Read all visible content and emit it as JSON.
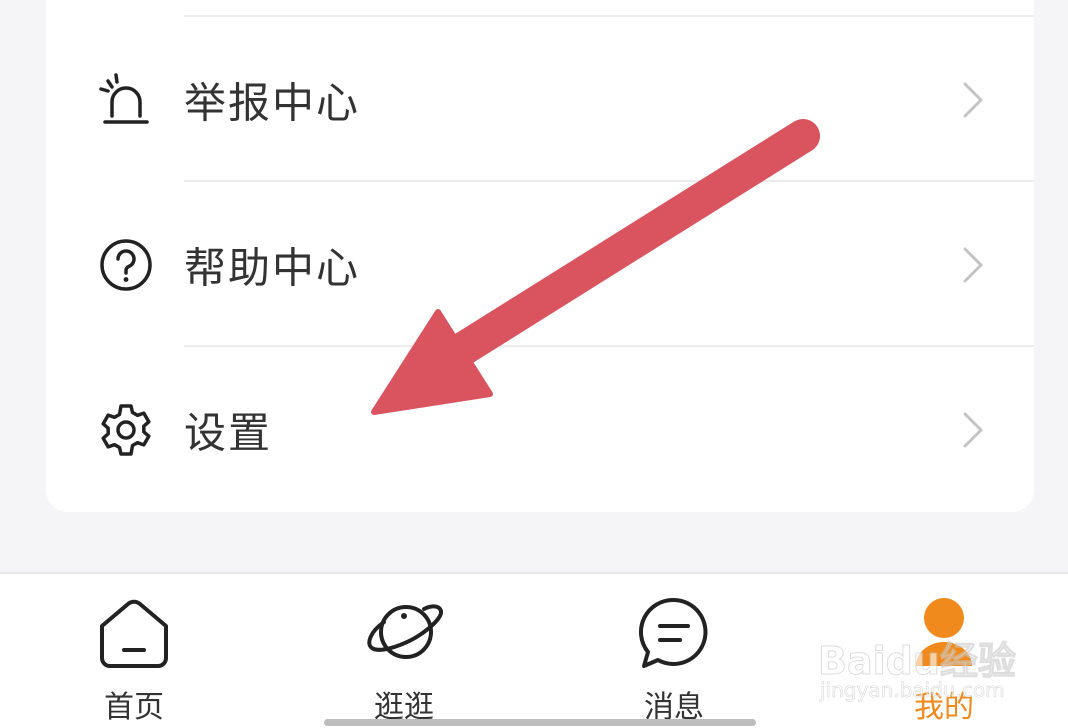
{
  "menu": {
    "items": [
      {
        "label": "举报中心",
        "icon": "alarm-icon"
      },
      {
        "label": "帮助中心",
        "icon": "help-circle-icon"
      },
      {
        "label": "设置",
        "icon": "gear-icon"
      }
    ]
  },
  "tabbar": {
    "tabs": [
      {
        "label": "首页",
        "icon": "home-icon",
        "active": false
      },
      {
        "label": "逛逛",
        "icon": "planet-icon",
        "active": false
      },
      {
        "label": "消息",
        "icon": "chat-bubble-icon",
        "active": false
      },
      {
        "label": "我的",
        "icon": "profile-icon",
        "active": true
      }
    ]
  },
  "annotation": {
    "arrow_color": "#d9545f",
    "points_to": "设置"
  },
  "watermark": {
    "brand": "Baidu经验",
    "url": "jingyan.baidu.com"
  },
  "colors": {
    "accent": "#f08a1c",
    "text": "#333333",
    "background": "#f5f5f7"
  }
}
